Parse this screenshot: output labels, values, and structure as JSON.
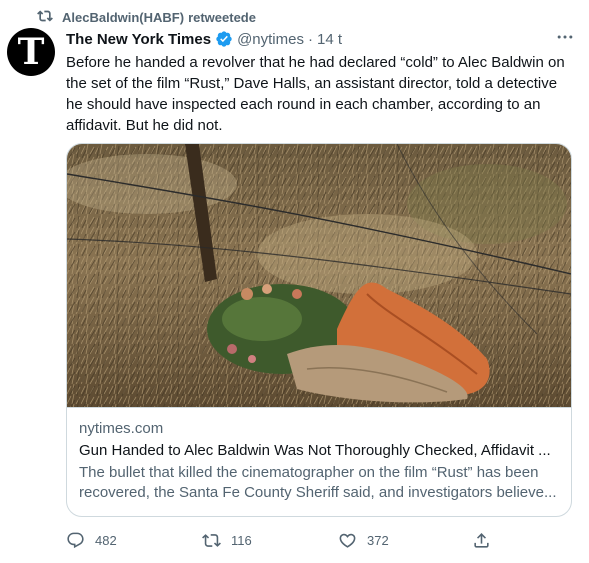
{
  "retweet": {
    "icon": "retweet-icon",
    "user": "AlecBaldwin(HABF)",
    "label": "retweetede"
  },
  "tweet": {
    "avatar_letter": "T",
    "author_name": "The New York Times",
    "verified_icon": "verified-badge-icon",
    "handle": "@nytimes",
    "separator": "·",
    "time": "14 t",
    "more_icon": "more-icon",
    "text": "Before he handed a revolver that he had declared “cold” to Alec Baldwin on the set of the film “Rust,” Dave Halls, an assistant director, told a detective he should have inspected each round in each chamber, according to an affidavit. But he did not."
  },
  "card": {
    "domain": "nytimes.com",
    "title": "Gun Handed to Alec Baldwin Was Not Thoroughly Checked, Affidavit ...",
    "description": "The bullet that killed the cinematographer on the film “Rust” has been recovered, the Santa Fe County Sheriff said, and investigators believe..."
  },
  "actions": {
    "replies": "482",
    "retweets": "116",
    "likes": "372"
  },
  "colors": {
    "text_primary": "#0f1419",
    "text_secondary": "#536471",
    "verified_blue": "#1d9bf0",
    "border": "#cfd9de"
  }
}
